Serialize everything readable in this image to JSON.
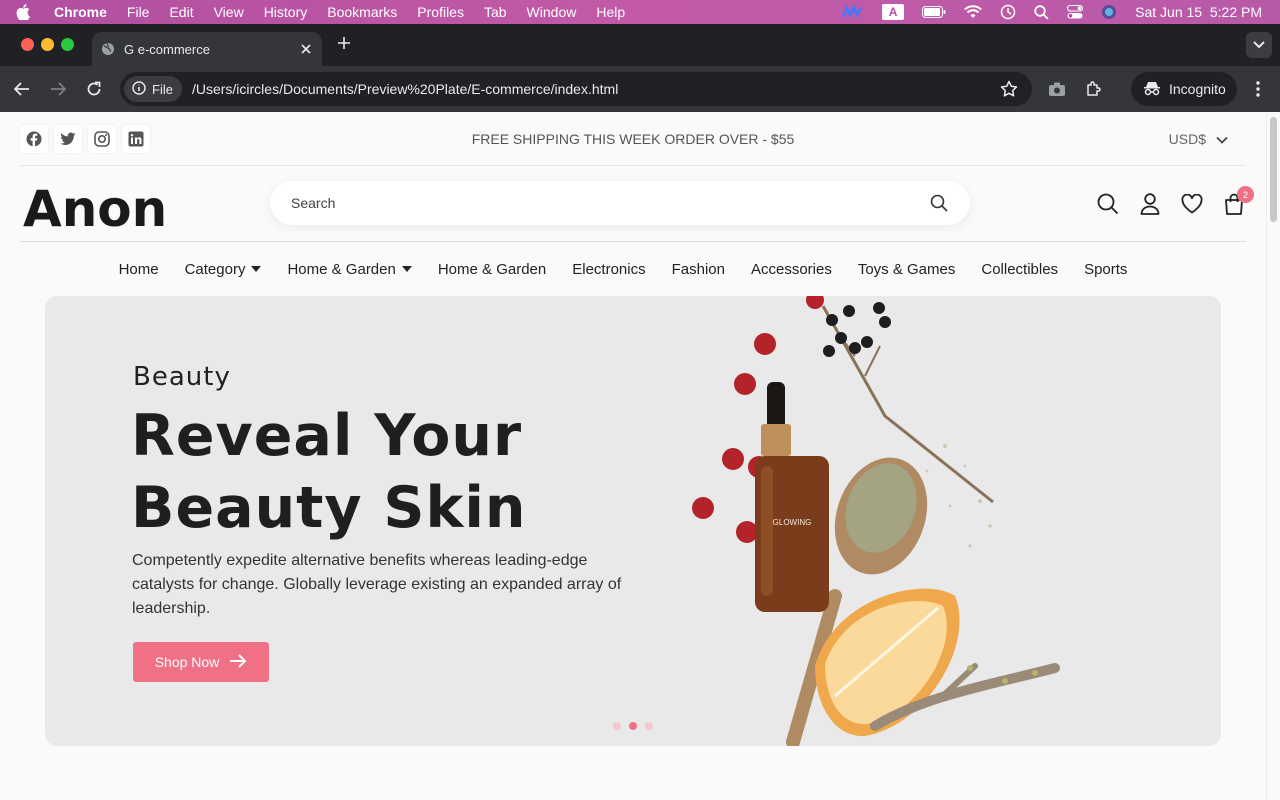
{
  "menubar": {
    "app": "Chrome",
    "items": [
      "File",
      "Edit",
      "View",
      "History",
      "Bookmarks",
      "Profiles",
      "Tab",
      "Window",
      "Help"
    ],
    "input_badge": "A",
    "datetime": "Sat Jun 15  5:22 PM"
  },
  "browser": {
    "tab_title": "G e-commerce",
    "address_scheme": "File",
    "url": "/Users/icircles/Documents/Preview%20Plate/E-commerce/index.html",
    "incognito_label": "Incognito"
  },
  "page": {
    "topbar": {
      "promo": "FREE SHIPPING THIS WEEK ORDER OVER - $55",
      "currency": "USD$"
    },
    "header": {
      "logo": "Anon",
      "search_placeholder": "Search",
      "cart_count": "2"
    },
    "nav": [
      {
        "label": "Home",
        "dropdown": false
      },
      {
        "label": "Category",
        "dropdown": true
      },
      {
        "label": "Home & Garden",
        "dropdown": true
      },
      {
        "label": "Home & Garden",
        "dropdown": false
      },
      {
        "label": "Electronics",
        "dropdown": false
      },
      {
        "label": "Fashion",
        "dropdown": false
      },
      {
        "label": "Accessories",
        "dropdown": false
      },
      {
        "label": "Toys & Games",
        "dropdown": false
      },
      {
        "label": "Collectibles",
        "dropdown": false
      },
      {
        "label": "Sports",
        "dropdown": false
      }
    ],
    "hero": {
      "subtitle": "Beauty",
      "title_line1": "Reveal Your",
      "title_line2": "Beauty Skin",
      "description": "Competently expedite alternative benefits whereas leading-edge catalysts for change. Globally leverage existing an expanded array of leadership.",
      "cta": "Shop Now",
      "bottle_label": "GLOWING",
      "active_slide": 2,
      "slide_count": 3
    }
  },
  "colors": {
    "accent": "#f07085",
    "hero_bg": "#e9e9e9",
    "menubar": "#b14fa0"
  }
}
